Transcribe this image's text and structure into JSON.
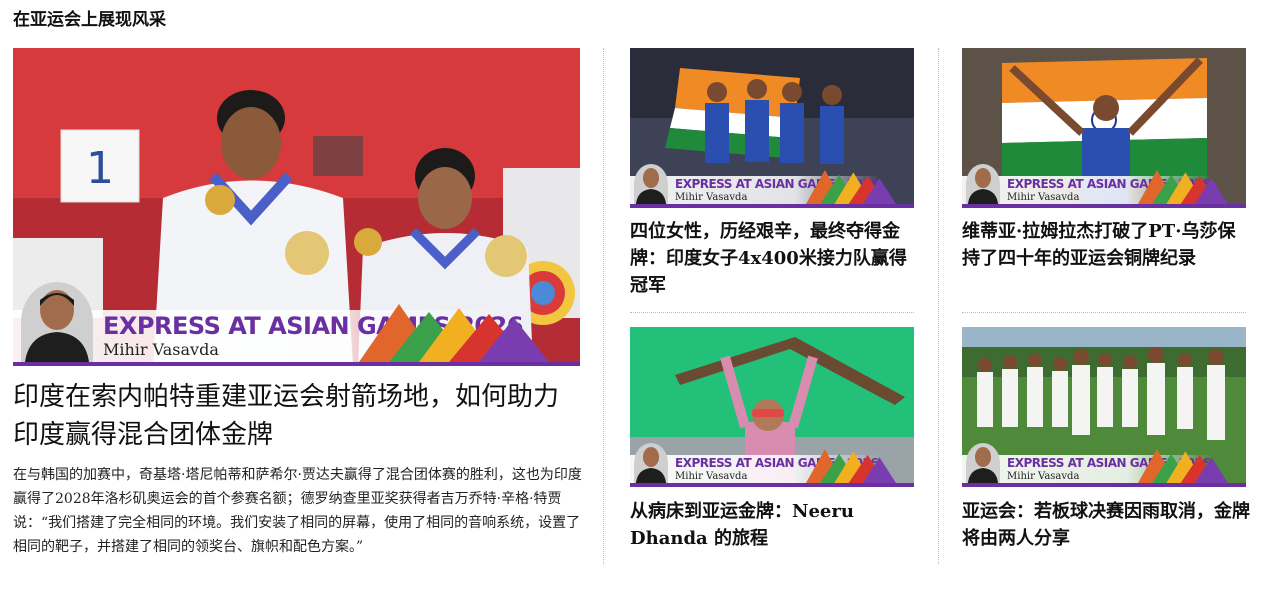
{
  "section": {
    "title": "在亚运会上展现风采"
  },
  "overlay": {
    "brand": "EXPRESS AT ASIAN GAMES 2026",
    "author": "Mihir Vasavda"
  },
  "colors": {
    "brand_purple": "#6a2fa0"
  },
  "main_story": {
    "headline": "印度在索内帕特重建亚运会射箭场地，如何助力印度赢得混合团体金牌",
    "summary": "在与韩国的加赛中，奇基塔·塔尼帕蒂和萨希尔·贾达夫赢得了混合团体赛的胜利，这也为印度赢得了2028年洛杉矶奥运会的首个参赛名额；德罗纳查里亚奖获得者吉万乔特·辛格·特贾说：“我们搭建了完全相同的环境。我们安装了相同的屏幕，使用了相同的音响系统，设置了相同的靶子，并搭建了相同的领奖台、旗帜和配色方案。”",
    "scoreboard_digit": "1"
  },
  "cards": [
    {
      "headline": "四位女性，历经艰辛，最终夺得金牌：印度女子4x400米接力队赢得冠军"
    },
    {
      "headline": "维蒂亚·拉姆拉杰打破了PT·乌莎保持了四十年的亚运会铜牌纪录"
    },
    {
      "headline": "从病床到亚运金牌：Neeru Dhanda 的旅程"
    },
    {
      "headline": "亚运会：若板球决赛因雨取消，金牌将由两人分享"
    }
  ]
}
